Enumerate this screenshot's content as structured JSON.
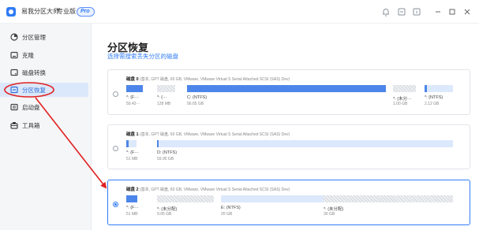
{
  "app": {
    "title": "易我分区大师",
    "edition": "专业版",
    "badge": "Pro"
  },
  "sidebar": {
    "items": [
      {
        "label": "分区管理",
        "icon": "pie-chart-icon",
        "active": false
      },
      {
        "label": "克隆",
        "icon": "clone-icon",
        "active": false
      },
      {
        "label": "磁盘转换",
        "icon": "disk-convert-icon",
        "active": false
      },
      {
        "label": "分区恢复",
        "icon": "partition-recovery-icon",
        "active": true
      },
      {
        "label": "启动盘",
        "icon": "boot-disk-icon",
        "active": false
      },
      {
        "label": "工具箱",
        "icon": "toolbox-icon",
        "active": false
      }
    ]
  },
  "main": {
    "title": "分区恢复",
    "subtitle": "选择需搜索丢失分区的磁盘"
  },
  "disks": [
    {
      "name": "磁盘 0",
      "details": "(基本, GPT 磁盘, 60 GB, VMware, VMware Virtual S Serial Attached SCSI (SAS) Dev)",
      "selected": false,
      "partitions": [
        {
          "label": "*: (F⋯",
          "size": "50.42⋯",
          "kind": "used"
        },
        {
          "label": "*: (⋯",
          "size": "128 MB",
          "kind": "unalloc"
        },
        {
          "label": "C: (NTFS)",
          "size": "56.65 GB",
          "kind": "used"
        },
        {
          "label": "*: (未分⋯",
          "size": "1.00 GB",
          "kind": "unalloc"
        },
        {
          "label": "*: (NTFS)",
          "size": "2.12 GB",
          "kind": "used"
        }
      ]
    },
    {
      "name": "磁盘 1",
      "details": "(基本, GPT 磁盘, 60 GB, VMware, VMware Virtual S Serial Attached SCSI (SAS) Dev)",
      "selected": false,
      "partitions": [
        {
          "label": "*: (F⋯",
          "size": "51 MB",
          "kind": "used"
        },
        {
          "label": "D: (NTFS)",
          "size": "59.95 GB",
          "kind": "free"
        }
      ]
    },
    {
      "name": "磁盘 2",
      "details": "(基本, GPT 磁盘, 60 GB, VMware, VMware Virtual S Serial Attached SCSI (SAS) Dev)",
      "selected": true,
      "partitions": [
        {
          "label": "*: (F⋯",
          "size": "51 MB",
          "kind": "used"
        },
        {
          "label": "*: (未分配)",
          "size": "9.95 GB",
          "kind": "unalloc"
        },
        {
          "label": "E: (NTFS)",
          "size": "20 GB",
          "kind": "free"
        },
        {
          "label": "*: (未分配)",
          "size": "30 GB",
          "kind": "unalloc"
        }
      ]
    }
  ],
  "colors": {
    "accent": "#2f7cf6",
    "used": "#4d86ea",
    "free": "#dce8fb",
    "annotation": "#e02020"
  }
}
